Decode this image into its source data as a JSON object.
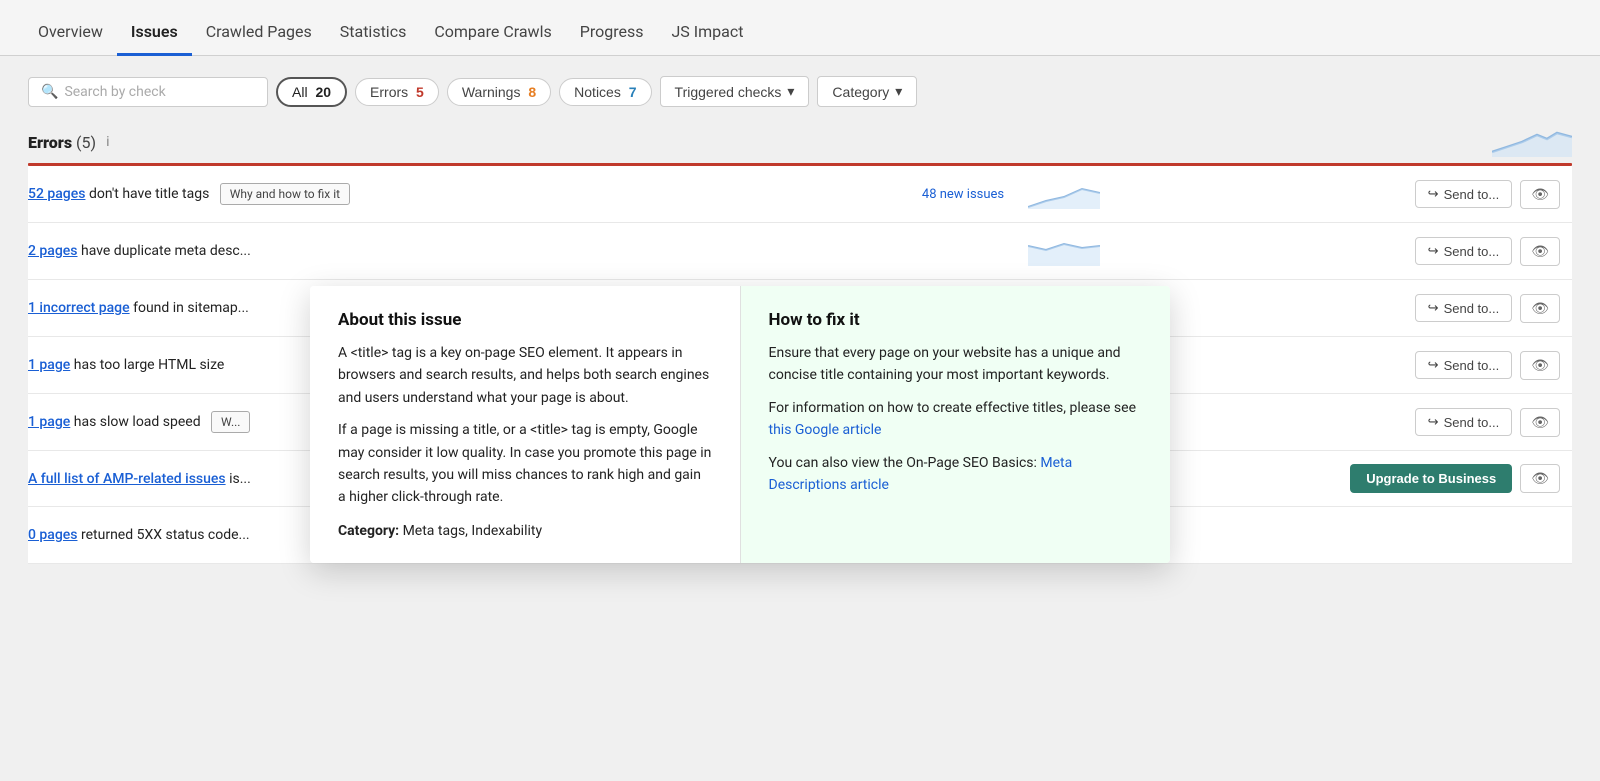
{
  "nav": {
    "items": [
      {
        "label": "Overview",
        "active": false
      },
      {
        "label": "Issues",
        "active": true
      },
      {
        "label": "Crawled Pages",
        "active": false
      },
      {
        "label": "Statistics",
        "active": false
      },
      {
        "label": "Compare Crawls",
        "active": false
      },
      {
        "label": "Progress",
        "active": false
      },
      {
        "label": "JS Impact",
        "active": false
      }
    ]
  },
  "filters": {
    "search_placeholder": "Search by check",
    "all_label": "All",
    "all_count": "20",
    "errors_label": "Errors",
    "errors_count": "5",
    "warnings_label": "Warnings",
    "warnings_count": "8",
    "notices_label": "Notices",
    "notices_count": "7",
    "triggered_checks_label": "Triggered checks",
    "category_label": "Category"
  },
  "errors_section": {
    "title": "Errors",
    "count": "(5)",
    "info_title": "i"
  },
  "rows": [
    {
      "id": 1,
      "text_before": "52 pages",
      "text_before_link": true,
      "text_after": " don't have title tags",
      "show_why": true,
      "why_label": "Why and how to fix it",
      "new_issues": "48 new issues",
      "has_sparkline": true,
      "send_label": "Send to...",
      "has_eye": true,
      "has_upgrade": false
    },
    {
      "id": 2,
      "text_before": "2 pages",
      "text_before_link": true,
      "text_after": " have duplicate meta desc...",
      "show_why": false,
      "new_issues": "",
      "has_sparkline": true,
      "send_label": "Send to...",
      "has_eye": true,
      "has_upgrade": false
    },
    {
      "id": 3,
      "text_before": "1 incorrect page",
      "text_before_link": true,
      "text_after": " found in sitemap...",
      "show_why": false,
      "new_issues": "",
      "has_sparkline": true,
      "send_label": "Send to...",
      "has_eye": true,
      "has_upgrade": false
    },
    {
      "id": 4,
      "text_before": "1 page",
      "text_before_link": true,
      "text_after": " has too large HTML size",
      "show_why": false,
      "new_issues": "",
      "has_sparkline": true,
      "send_label": "Send to...",
      "has_eye": true,
      "has_upgrade": false
    },
    {
      "id": 5,
      "text_before": "1 page",
      "text_before_link": true,
      "text_after": " has slow load speed",
      "show_why": true,
      "why_label": "W...",
      "new_issues": "",
      "has_sparkline": true,
      "send_label": "Send to...",
      "has_eye": true,
      "has_upgrade": false
    },
    {
      "id": 6,
      "text_before": "A full list of AMP-related issues",
      "text_before_link": true,
      "text_after": " is...",
      "show_why": false,
      "new_issues": "",
      "has_sparkline": false,
      "send_label": "",
      "has_eye": true,
      "has_upgrade": true,
      "upgrade_label": "Upgrade to Business"
    },
    {
      "id": 7,
      "text_before": "0 pages",
      "text_before_link": true,
      "text_after": " returned 5XX status code...",
      "show_why": false,
      "new_issues": "",
      "has_sparkline": true,
      "send_label": "",
      "has_eye": false,
      "has_upgrade": false
    }
  ],
  "popup": {
    "left_title": "About this issue",
    "left_paragraphs": [
      "A <title> tag is a key on-page SEO element. It appears in browsers and search results, and helps both search engines and users understand what your page is about.",
      "If a page is missing a title, or a <title> tag is empty, Google may consider it low quality. In case you promote this page in search results, you will miss chances to rank high and gain a higher click-through rate."
    ],
    "left_category_label": "Category:",
    "left_category_value": "Meta tags, Indexability",
    "right_title": "How to fix it",
    "right_text1": "Ensure that every page on your website has a unique and concise title containing your most important keywords.",
    "right_text2": "For information on how to create effective titles, please see ",
    "right_link1_label": "this Google article",
    "right_text3": "You can also view the On-Page SEO Basics: ",
    "right_link2_label": "Meta Descriptions article"
  }
}
